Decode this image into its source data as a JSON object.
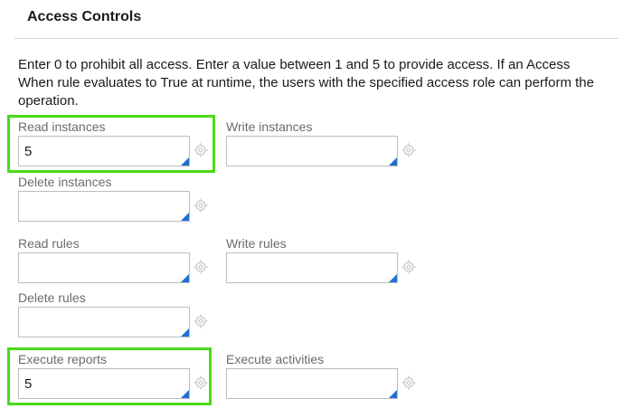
{
  "section": {
    "title": "Access Controls",
    "description": "Enter 0 to prohibit all access. Enter a value between 1 and 5 to provide access. If an Access When rule evaluates to True at runtime, the users with the specified access role can perform the operation."
  },
  "fields": {
    "read_instances": {
      "label": "Read instances",
      "value": "5"
    },
    "write_instances": {
      "label": "Write instances",
      "value": ""
    },
    "delete_instances": {
      "label": "Delete instances",
      "value": ""
    },
    "read_rules": {
      "label": "Read rules",
      "value": ""
    },
    "write_rules": {
      "label": "Write rules",
      "value": ""
    },
    "delete_rules": {
      "label": "Delete rules",
      "value": ""
    },
    "execute_reports": {
      "label": "Execute reports",
      "value": "5"
    },
    "execute_activities": {
      "label": "Execute activities",
      "value": ""
    }
  },
  "colors": {
    "highlight": "#4cd91a",
    "accent_corner": "#1f6fd1",
    "target_icon": "#c8c8c8"
  },
  "icons": {
    "field_picker": "target-icon",
    "field_corner": "smart-prompt-corner-icon"
  }
}
